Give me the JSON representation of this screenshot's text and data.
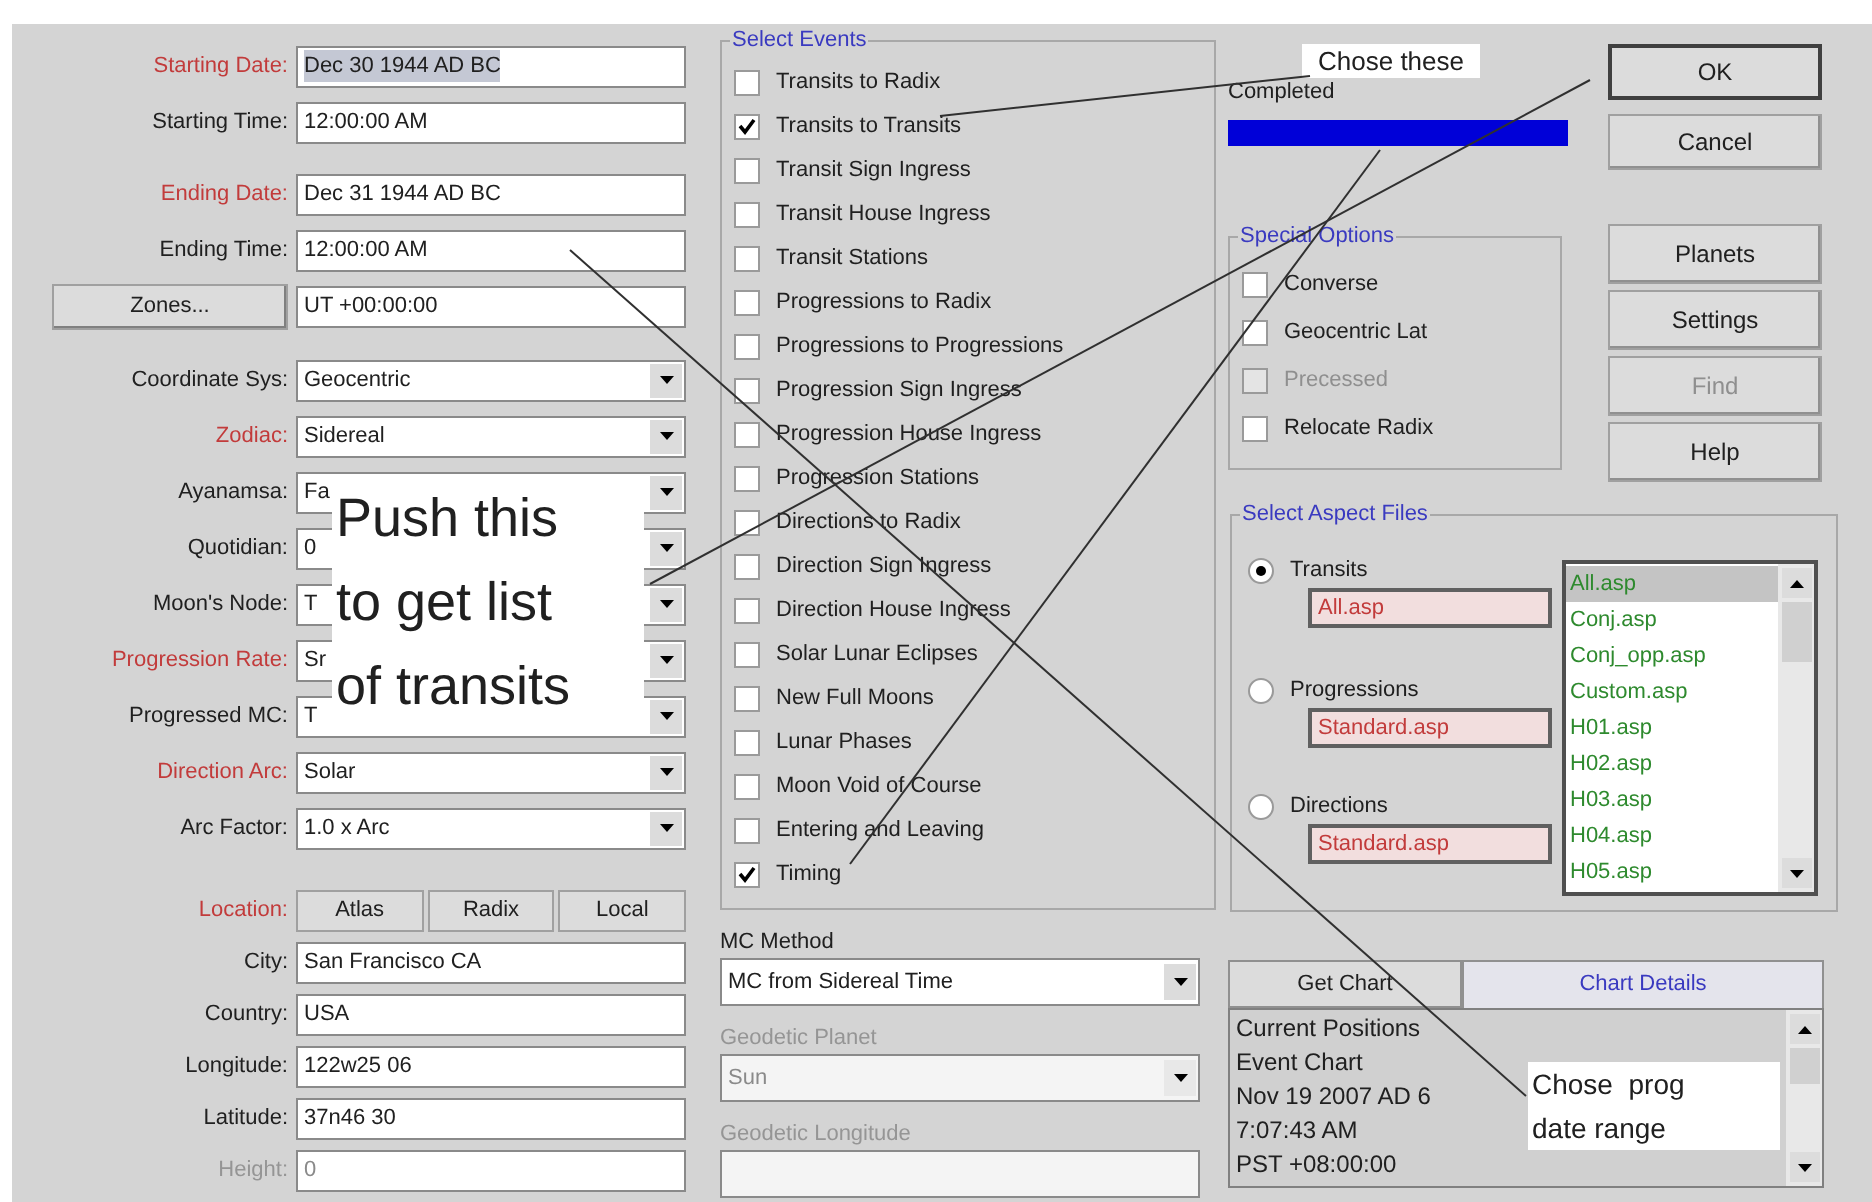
{
  "settings": [
    {
      "items": [
        {
          "kind": "field",
          "label": "Starting Date:",
          "red": true,
          "disabled": false,
          "value": "Dec 30 1944 AD BC",
          "value_highlighted": true
        },
        {
          "kind": "field",
          "label": "Starting Time:",
          "red": false,
          "disabled": false,
          "value": "12:00:00 AM",
          "value_highlighted": false
        }
      ]
    },
    {
      "items": [
        {
          "kind": "field",
          "label": "Ending Date:",
          "red": true,
          "disabled": false,
          "value": "Dec 31 1944 AD BC",
          "value_highlighted": false
        },
        {
          "kind": "field",
          "label": "Ending Time:",
          "red": false,
          "disabled": false,
          "value": "12:00:00 AM",
          "value_highlighted": false
        }
      ]
    },
    {
      "items": [
        {
          "kind": "button_field",
          "button": "Zones...",
          "red": false,
          "disabled": false,
          "value": "UT +00:00:00",
          "value_highlighted": false
        }
      ]
    },
    {
      "items": [
        {
          "kind": "dropdown",
          "label": "Coordinate Sys:",
          "red": false,
          "disabled": false,
          "value": "Geocentric"
        },
        {
          "kind": "dropdown",
          "label": "Zodiac:",
          "red": true,
          "disabled": false,
          "value": "Sidereal"
        },
        {
          "kind": "dropdown",
          "label": "Ayanamsa:",
          "red": false,
          "disabled": false,
          "value": "Fa"
        },
        {
          "kind": "dropdown",
          "label": "Quotidian:",
          "red": false,
          "disabled": false,
          "value": "0"
        },
        {
          "kind": "dropdown",
          "label": "Moon's Node:",
          "red": false,
          "disabled": false,
          "value": "T"
        },
        {
          "kind": "dropdown",
          "label": "Progression Rate:",
          "red": true,
          "disabled": false,
          "value": "Sr"
        },
        {
          "kind": "dropdown",
          "label": "Progressed MC:",
          "red": false,
          "disabled": false,
          "value": "T"
        },
        {
          "kind": "dropdown",
          "label": "Direction Arc:",
          "red": true,
          "disabled": false,
          "value": "Solar"
        },
        {
          "kind": "dropdown",
          "label": "Arc Factor:",
          "red": false,
          "disabled": false,
          "value": "1.0 x Arc"
        }
      ]
    },
    {
      "items": [
        {
          "kind": "buttons",
          "label": "Location:",
          "red": true,
          "disabled": false,
          "buttons": [
            "Atlas",
            "Radix",
            "Local"
          ]
        },
        {
          "kind": "field",
          "label": "City:",
          "red": false,
          "disabled": false,
          "value": "San Francisco CA",
          "value_highlighted": false
        },
        {
          "kind": "field",
          "label": "Country:",
          "red": false,
          "disabled": false,
          "value": "USA",
          "value_highlighted": false
        },
        {
          "kind": "field",
          "label": "Longitude:",
          "red": false,
          "disabled": false,
          "value": "122w25 06",
          "value_highlighted": false
        },
        {
          "kind": "field",
          "label": "Latitude:",
          "red": false,
          "disabled": false,
          "value": "37n46 30",
          "value_highlighted": false
        },
        {
          "kind": "field",
          "label": "Height:",
          "red": false,
          "disabled": true,
          "value": "0",
          "value_highlighted": false
        }
      ]
    }
  ],
  "events": {
    "title": "Select Events",
    "items": [
      {
        "label": "Transits to Radix",
        "checked": false
      },
      {
        "label": "Transits to Transits",
        "checked": true
      },
      {
        "label": "Transit Sign Ingress",
        "checked": false
      },
      {
        "label": "Transit House Ingress",
        "checked": false
      },
      {
        "label": "Transit Stations",
        "checked": false
      },
      {
        "label": "Progressions to Radix",
        "checked": false
      },
      {
        "label": "Progressions to Progressions",
        "checked": false
      },
      {
        "label": "Progression Sign Ingress",
        "checked": false
      },
      {
        "label": "Progression House Ingress",
        "checked": false
      },
      {
        "label": "Progression Stations",
        "checked": false
      },
      {
        "label": "Directions to Radix",
        "checked": false
      },
      {
        "label": "Direction Sign Ingress",
        "checked": false
      },
      {
        "label": "Direction House Ingress",
        "checked": false
      },
      {
        "label": "Solar Lunar Eclipses",
        "checked": false
      },
      {
        "label": "New Full Moons",
        "checked": false
      },
      {
        "label": "Lunar Phases",
        "checked": false
      },
      {
        "label": "Moon Void of Course",
        "checked": false
      },
      {
        "label": "Entering and Leaving",
        "checked": false
      },
      {
        "label": "Timing",
        "checked": true
      }
    ]
  },
  "mc_method": {
    "label": "MC Method",
    "value": "MC from Sidereal Time",
    "disabled": false
  },
  "geodetic_planet": {
    "label": "Geodetic Planet",
    "value": "Sun",
    "disabled": true
  },
  "geodetic_longitude": {
    "label": "Geodetic Longitude",
    "disabled": true
  },
  "progress": {
    "label": "Completed",
    "level": 1
  },
  "buttons": [
    {
      "label": "OK",
      "default": true,
      "disabled": false
    },
    {
      "label": "Cancel",
      "default": false,
      "disabled": false
    },
    {
      "label": "Planets",
      "default": false,
      "disabled": false
    },
    {
      "label": "Settings",
      "default": false,
      "disabled": false
    },
    {
      "label": "Find",
      "default": false,
      "disabled": true
    },
    {
      "label": "Help",
      "default": false,
      "disabled": false
    }
  ],
  "special_options": {
    "title": "Special Options",
    "items": [
      {
        "label": "Converse",
        "checked": false,
        "disabled": false
      },
      {
        "label": "Geocentric Lat",
        "checked": false,
        "disabled": false
      },
      {
        "label": "Precessed",
        "checked": false,
        "disabled": true
      },
      {
        "label": "Relocate Radix",
        "checked": false,
        "disabled": false
      }
    ]
  },
  "aspect_files": {
    "title": "Select Aspect Files",
    "items": [
      {
        "label": "Transits",
        "selected": true,
        "file": "All.asp"
      },
      {
        "label": "Progressions",
        "selected": false,
        "file": "Standard.asp"
      },
      {
        "label": "Directions",
        "selected": false,
        "file": "Standard.asp"
      }
    ],
    "list": [
      {
        "label": "All.asp",
        "selected": true
      },
      {
        "label": "Conj.asp",
        "selected": false
      },
      {
        "label": "Conj_opp.asp",
        "selected": false
      },
      {
        "label": "Custom.asp",
        "selected": false
      },
      {
        "label": "H01.asp",
        "selected": false
      },
      {
        "label": "H02.asp",
        "selected": false
      },
      {
        "label": "H03.asp",
        "selected": false
      },
      {
        "label": "H04.asp",
        "selected": false
      },
      {
        "label": "H05.asp",
        "selected": false
      }
    ]
  },
  "chart_tabs": [
    {
      "label": "Get Chart",
      "selected": false
    },
    {
      "label": "Chart Details",
      "selected": true
    }
  ],
  "chart_details": [
    "Current Positions",
    "Event Chart",
    "Nov 19 2007 AD 6",
    "7:07:43 AM",
    "PST +08:00:00"
  ],
  "annotations": [
    {
      "kind": "big",
      "lines": [
        "Push this",
        "to get list",
        "of transits"
      ]
    },
    {
      "kind": "top",
      "lines": [
        "Chose these"
      ]
    },
    {
      "kind": "bottom",
      "lines": [
        "Chose  prog",
        "date range"
      ]
    }
  ]
}
